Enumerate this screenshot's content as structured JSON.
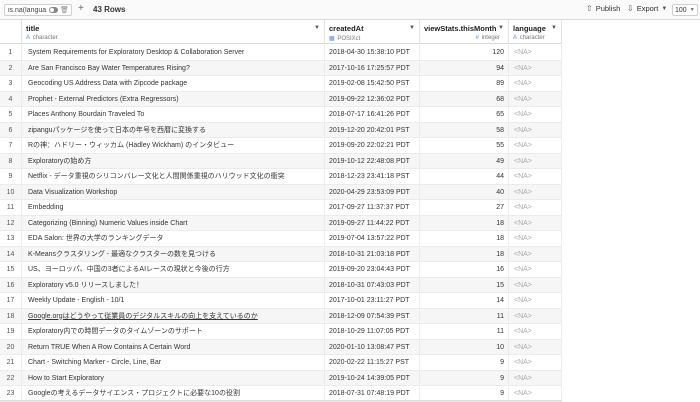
{
  "toolbar": {
    "filter_text": "is.na(langua...",
    "rows_label": "43 Rows",
    "publish_label": "Publish",
    "export_label": "Export",
    "page_size": "100"
  },
  "columns": [
    {
      "name": "title",
      "type": "character",
      "type_icon": "A"
    },
    {
      "name": "createdAt",
      "type": "POSIXct",
      "type_icon": "calendar-icon"
    },
    {
      "name": "viewStats.thisMonth",
      "type": "integer",
      "type_icon": "#"
    },
    {
      "name": "language",
      "type": "character",
      "type_icon": "A"
    }
  ],
  "rows": [
    {
      "idx": "1",
      "title": "System Requirements for Exploratory Desktop & Collaboration Server",
      "createdAt": "2018-04-30 15:38:10 PDT",
      "views": "120",
      "language": "<NA>"
    },
    {
      "idx": "2",
      "title": "Are San Francisco Bay Water Temperatures Rising?",
      "createdAt": "2017-10-16 17:25:57 PDT",
      "views": "94",
      "language": "<NA>"
    },
    {
      "idx": "3",
      "title": "Geocoding US Address Data with Zipcode package",
      "createdAt": "2019-02-08 15:42:50 PST",
      "views": "89",
      "language": "<NA>"
    },
    {
      "idx": "4",
      "title": "Prophet - External Predictors (Extra Regressors)",
      "createdAt": "2019-09-22 12:36:02 PDT",
      "views": "68",
      "language": "<NA>"
    },
    {
      "idx": "5",
      "title": "Places Anthony Bourdain Traveled To",
      "createdAt": "2018-07-17 16:41:26 PDT",
      "views": "65",
      "language": "<NA>"
    },
    {
      "idx": "6",
      "title": "zipanguパッケージを使って日本の年号を西暦に変換する",
      "createdAt": "2019-12-20 20:42:01 PST",
      "views": "58",
      "language": "<NA>"
    },
    {
      "idx": "7",
      "title": "Rの神：ハドリー・ウィッカム (Hadley Wickham) のインタビュー",
      "createdAt": "2019-09-20 22:02:21 PDT",
      "views": "55",
      "language": "<NA>"
    },
    {
      "idx": "8",
      "title": "Exploratoryの始め方",
      "createdAt": "2019-10-12 22:48:08 PDT",
      "views": "49",
      "language": "<NA>"
    },
    {
      "idx": "9",
      "title": "Netflix - データ重視のシリコンバレー文化と人間関係重視のハリウッド文化の衝突",
      "createdAt": "2018-12-23 23:41:18 PST",
      "views": "44",
      "language": "<NA>"
    },
    {
      "idx": "10",
      "title": "Data Visualization Workshop",
      "createdAt": "2020-04-29 23:53:09 PDT",
      "views": "40",
      "language": "<NA>"
    },
    {
      "idx": "11",
      "title": "Embedding",
      "createdAt": "2017-09-27 11:37:37 PDT",
      "views": "27",
      "language": "<NA>"
    },
    {
      "idx": "12",
      "title": "Categorizing (Binning) Numeric Values inside Chart",
      "createdAt": "2019-09-27 11:44:22 PDT",
      "views": "18",
      "language": "<NA>"
    },
    {
      "idx": "13",
      "title": "EDA Salon: 世界の大学のランキングデータ",
      "createdAt": "2019-07-04 13:57:22 PDT",
      "views": "18",
      "language": "<NA>"
    },
    {
      "idx": "14",
      "title": "K-Meansクラスタリング - 最適なクラスターの数を見つける",
      "createdAt": "2018-10-31 21:03:18 PDT",
      "views": "18",
      "language": "<NA>"
    },
    {
      "idx": "15",
      "title": "US、ヨーロッパ、中国の3者によるAIレースの現状と今後の行方",
      "createdAt": "2019-09-20 23:04:43 PDT",
      "views": "16",
      "language": "<NA>"
    },
    {
      "idx": "16",
      "title": "Exploratory v5.0 リリースしました！",
      "createdAt": "2018-10-31 07:43:03 PDT",
      "views": "15",
      "language": "<NA>"
    },
    {
      "idx": "17",
      "title": "Weekly Update - English - 10/1",
      "createdAt": "2017-10-01 23:11:27 PDT",
      "views": "14",
      "language": "<NA>"
    },
    {
      "idx": "18",
      "title": "Google.orgはどうやって従業員のデジタルスキルの向上を支えているのか",
      "createdAt": "2018-12-09 07:54:39 PST",
      "views": "11",
      "language": "<NA>"
    },
    {
      "idx": "19",
      "title": "Exploratory内での時間データのタイムゾーンのサポート",
      "createdAt": "2018-10-29 11:07:05 PDT",
      "views": "11",
      "language": "<NA>"
    },
    {
      "idx": "20",
      "title": "Return TRUE When A Row Contains A Certain Word",
      "createdAt": "2020-01-10 13:08:47 PST",
      "views": "10",
      "language": "<NA>"
    },
    {
      "idx": "21",
      "title": "Chart - Switching Marker - Circle, Line, Bar",
      "createdAt": "2020-02-22 11:15:27 PST",
      "views": "9",
      "language": "<NA>"
    },
    {
      "idx": "22",
      "title": "How to Start Exploratory",
      "createdAt": "2019-10-24 14:39:05 PDT",
      "views": "9",
      "language": "<NA>"
    },
    {
      "idx": "23",
      "title": "Googleの考えるデータサイエンス・プロジェクトに必要な10の役割",
      "createdAt": "2018-07-31 07:48:19 PDT",
      "views": "9",
      "language": "<NA>"
    }
  ]
}
